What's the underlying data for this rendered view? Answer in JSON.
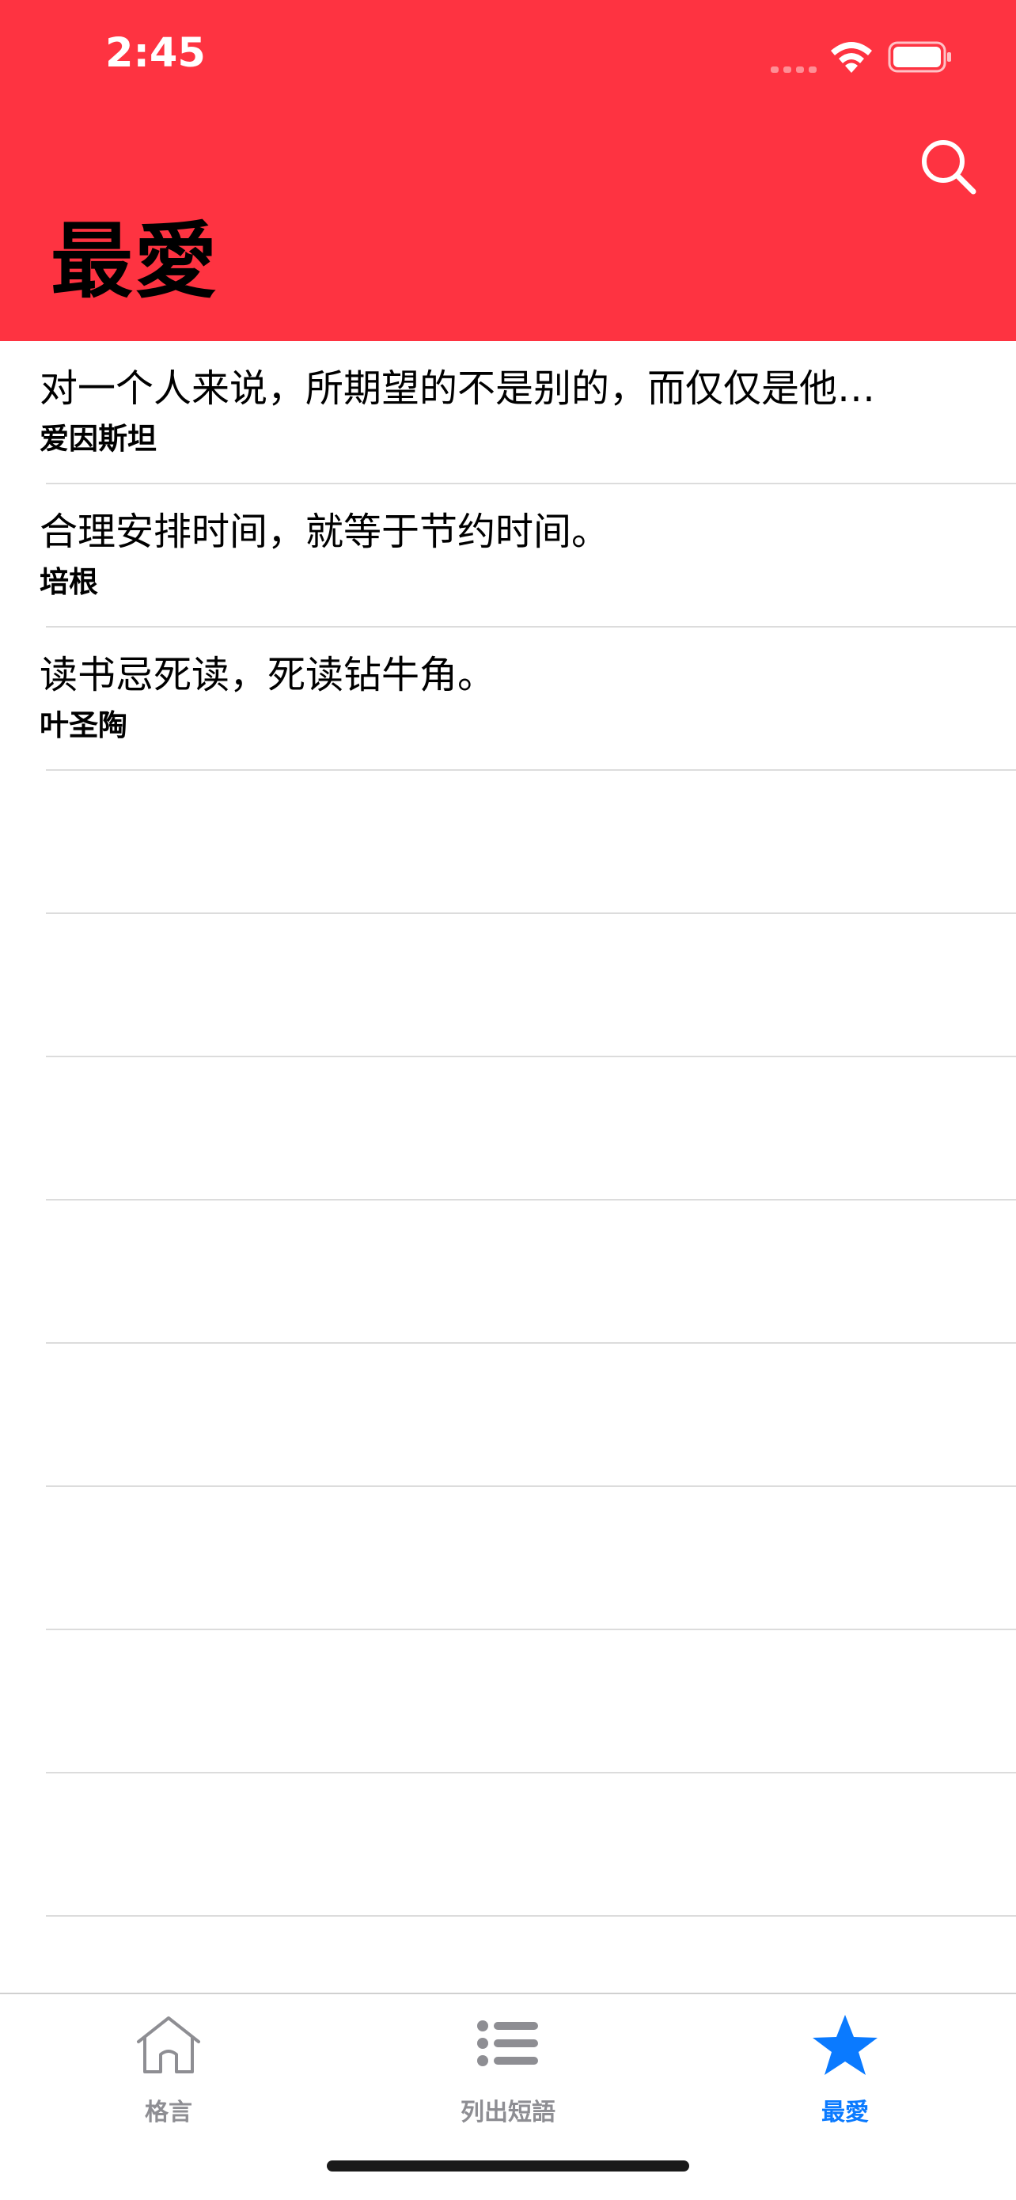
{
  "status_bar": {
    "time": "2:45"
  },
  "nav": {
    "title": "最愛"
  },
  "favorites": [
    {
      "quote": "对一个人来说，所期望的不是别的，而仅仅是他…",
      "author": "爱因斯坦"
    },
    {
      "quote": "合理安排时间，就等于节约时间。",
      "author": "培根"
    },
    {
      "quote": "读书忌死读，死读钻牛角。",
      "author": "叶圣陶"
    }
  ],
  "tabs": [
    {
      "label": "格言",
      "icon": "house-icon",
      "active": false
    },
    {
      "label": "列出短語",
      "icon": "list-icon",
      "active": false
    },
    {
      "label": "最愛",
      "icon": "star-icon",
      "active": true
    }
  ],
  "colors": {
    "header": "#fe3341",
    "accent": "#0a7aff",
    "inactive": "#8e8e93"
  }
}
